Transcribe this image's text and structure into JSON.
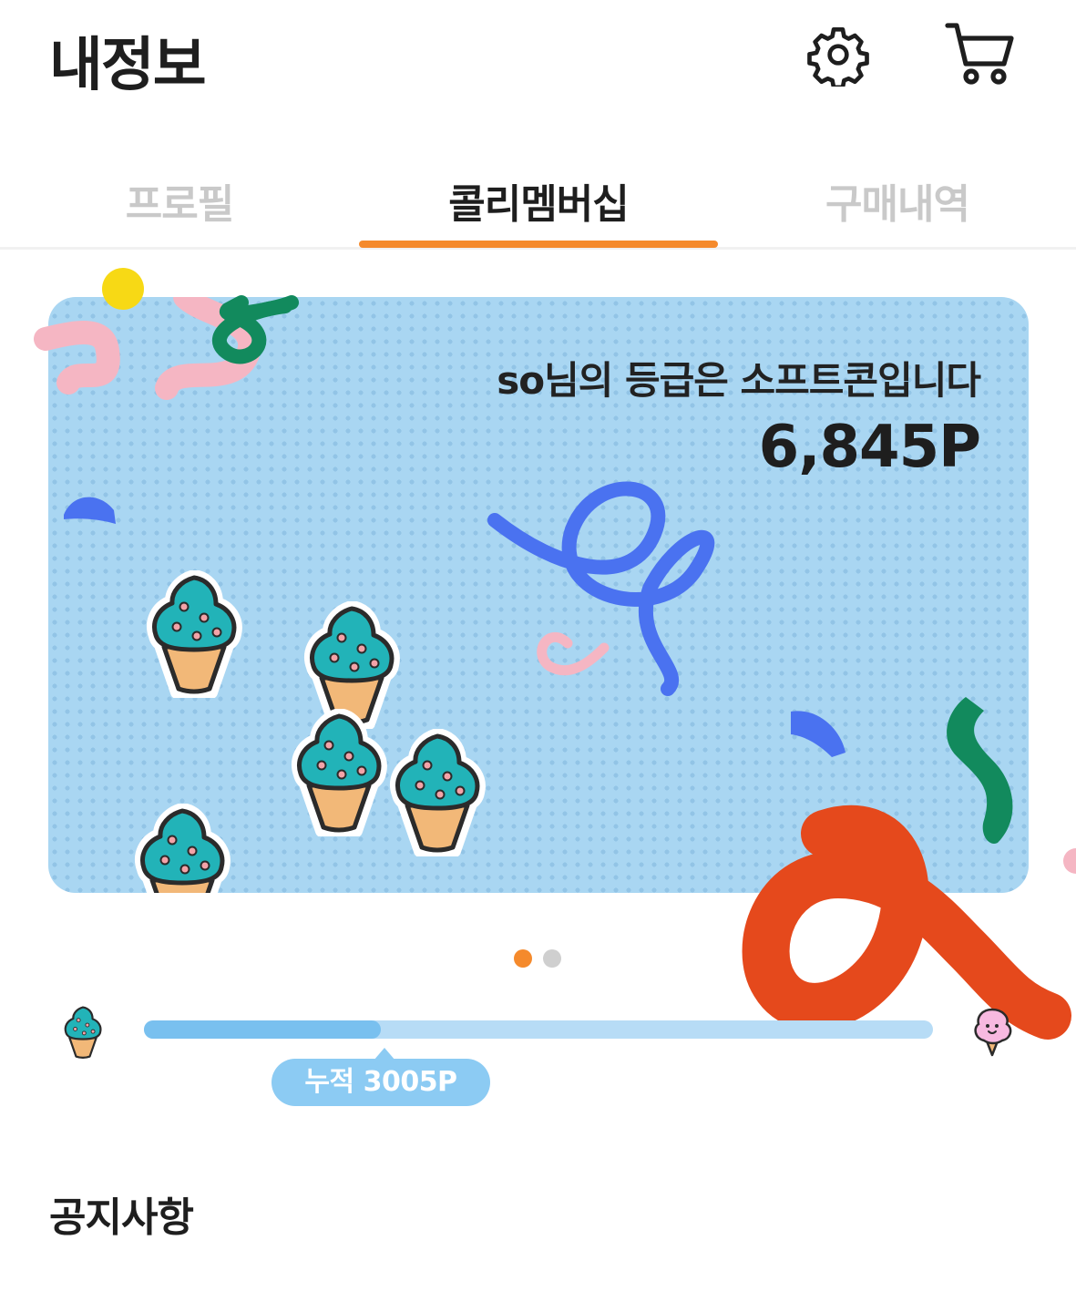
{
  "header": {
    "title": "내정보",
    "settings_icon": "gear-icon",
    "cart_icon": "shopping-cart-icon"
  },
  "tabs": [
    {
      "label": "프로필",
      "active": false
    },
    {
      "label": "콜리멤버십",
      "active": true
    },
    {
      "label": "구매내역",
      "active": false
    }
  ],
  "membership_card": {
    "grade_text": "so님의 등급은 소프트콘입니다",
    "points": "6,845P",
    "tier_illustration": "soft-serve-ice-cream-cone"
  },
  "carousel": {
    "total_pages": 2,
    "active_index": 0
  },
  "progress": {
    "accumulated_label": "누적 3005P",
    "fill_fraction": 0.3,
    "start_tier_icon": "soft-serve-cone-icon",
    "end_tier_icon": "pink-cotton-candy-icon"
  },
  "notice": {
    "title": "공지사항"
  },
  "colors": {
    "accent_orange": "#f58a2c",
    "card_blue": "#a9d6f2",
    "progress_fill": "#79c0ef",
    "progress_track": "#b7dcf6",
    "pill_blue": "#8ccbf3",
    "ribbon_red": "#e5491c",
    "ribbon_blue": "#4a72f0",
    "ribbon_green": "#128a5d",
    "ribbon_pink": "#f5b6c3",
    "cone_teal": "#22b3b8"
  }
}
